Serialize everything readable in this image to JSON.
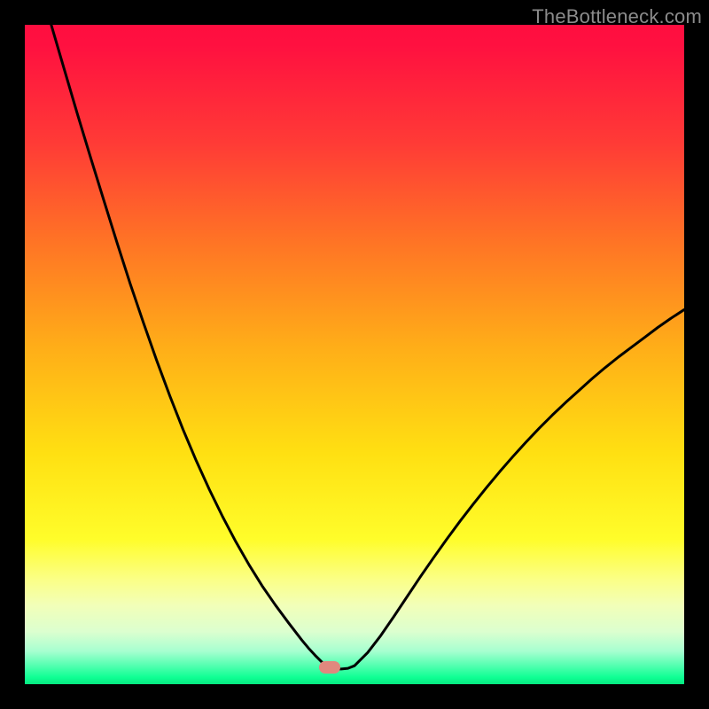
{
  "watermark": "TheBottleneck.com",
  "marker": {
    "x_pct": 46.3,
    "y_pct": 97.5,
    "color": "#e0887e"
  },
  "chart_data": {
    "type": "line",
    "title": "",
    "xlabel": "",
    "ylabel": "",
    "xlim": [
      0,
      100
    ],
    "ylim": [
      0,
      100
    ],
    "x": [
      4,
      6,
      8,
      10,
      12,
      14,
      16,
      18,
      20,
      22,
      24,
      26,
      28,
      30,
      32,
      34,
      36,
      38,
      40,
      42,
      43,
      44,
      45,
      46,
      47,
      48,
      49,
      50,
      52,
      54,
      56,
      58,
      60,
      62,
      64,
      66,
      68,
      70,
      72,
      74,
      76,
      78,
      80,
      82,
      84,
      86,
      88,
      90,
      92,
      94,
      96,
      98,
      100
    ],
    "values": [
      100,
      93.2,
      86.4,
      79.8,
      73.3,
      66.9,
      60.7,
      54.8,
      49.1,
      43.7,
      38.6,
      33.9,
      29.5,
      25.4,
      21.6,
      18.1,
      14.9,
      12.0,
      9.3,
      6.7,
      5.5,
      4.4,
      3.4,
      2.6,
      2.3,
      2.3,
      2.4,
      2.8,
      4.8,
      7.4,
      10.3,
      13.3,
      16.3,
      19.2,
      22.0,
      24.7,
      27.3,
      29.8,
      32.2,
      34.5,
      36.7,
      38.8,
      40.8,
      42.7,
      44.5,
      46.3,
      48.0,
      49.6,
      51.1,
      52.6,
      54.1,
      55.5,
      56.8
    ],
    "note": "Values are bottleneck percentage (100=top/red, 0=bottom/green). Curve descends from upper-left to a minimum near x≈46 then rises toward upper-right.",
    "background_gradient": {
      "top_color": "#ff0e3f",
      "mid_color": "#ffe012",
      "bottom_color": "#06e880"
    }
  }
}
